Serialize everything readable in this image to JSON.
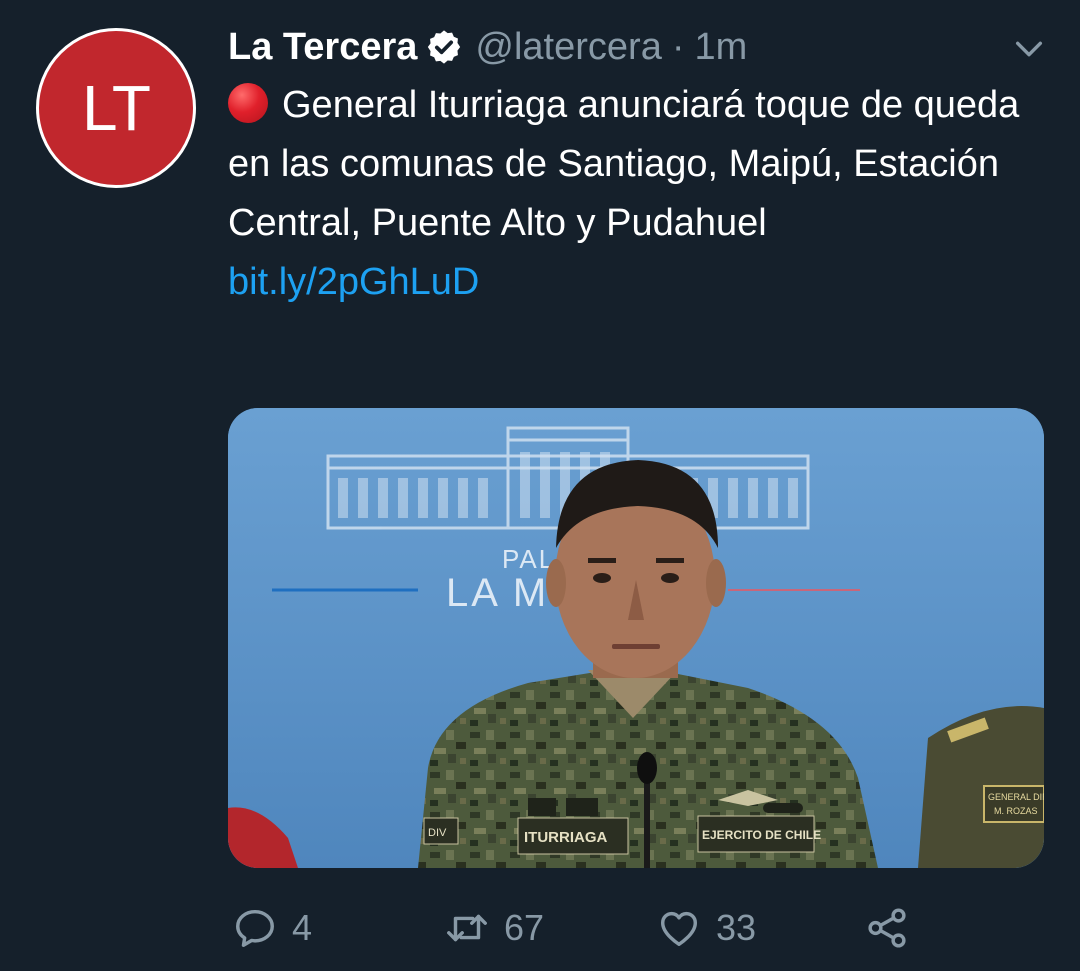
{
  "avatar": {
    "initials": "LT",
    "bg_color": "#c1272d"
  },
  "author": {
    "display_name": "La Tercera",
    "verified_icon": "verified-badge-icon",
    "handle": "@latercera",
    "separator": "·",
    "time": "1m"
  },
  "menu_icon": "chevron-down-icon",
  "tweet": {
    "emoji": "red-circle-icon",
    "text": "General Iturriaga anunciará toque de queda en las comunas de Santiago, Maipú, Estación Central, Puente Alto y Pudahuel",
    "link": "bit.ly/2pGhLuD"
  },
  "media": {
    "sign_line1": "PALAC",
    "sign_line2": "LA MO",
    "name_tape": "ITURRIAGA",
    "branch_tape": "EJERCITO DE CHILE",
    "rank_patch": "DIV",
    "right_tag_line1": "GENERAL DIR",
    "right_tag_line2": "M. ROZAS"
  },
  "actions": {
    "reply": {
      "icon": "reply-icon",
      "count": "4"
    },
    "retweet": {
      "icon": "retweet-icon",
      "count": "67"
    },
    "like": {
      "icon": "heart-icon",
      "count": "33"
    },
    "share": {
      "icon": "share-icon"
    }
  },
  "colors": {
    "background": "#15202b",
    "secondary_text": "#8899a6",
    "link": "#1da1f2",
    "verified": "#ffffff"
  }
}
